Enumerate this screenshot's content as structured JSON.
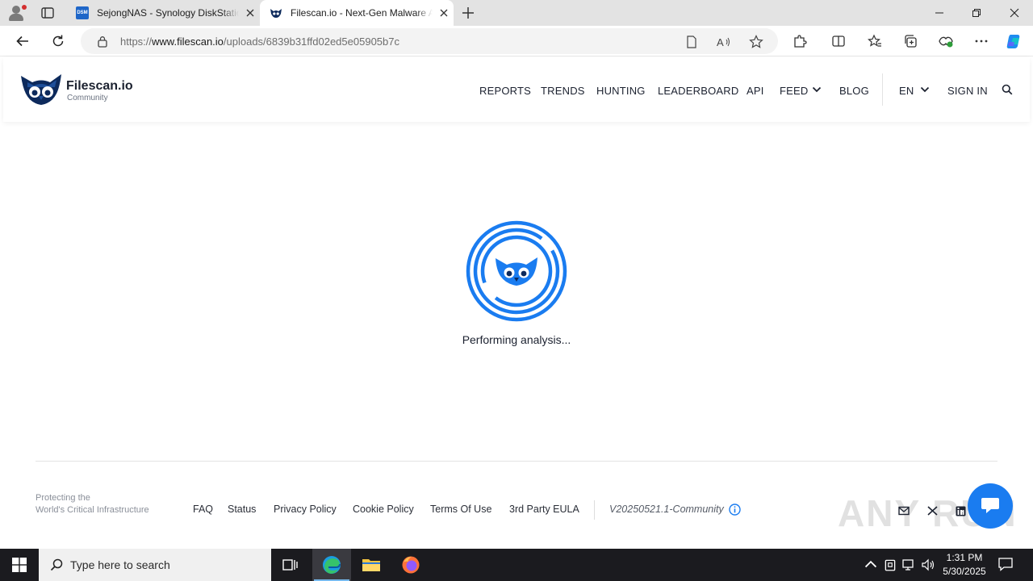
{
  "browser": {
    "tabs": [
      {
        "title": "SejongNAS - Synology DiskStation",
        "favicon": "DSM"
      },
      {
        "title": "Filescan.io - Next-Gen Malware Analysis"
      }
    ],
    "url_prefix": "https://",
    "url_domain": "www.filescan.io",
    "url_path": "/uploads/6839b31ffd02ed5e05905b7c"
  },
  "site": {
    "brand": "Filescan.io",
    "brand_sub": "Community",
    "nav": {
      "reports": "REPORTS",
      "trends": "TRENDS",
      "hunting": "HUNTING",
      "leaderboard": "LEADERBOARD",
      "api": "API",
      "feed": "FEED",
      "blog": "BLOG",
      "language": "EN",
      "signin": "SIGN IN"
    },
    "status": "Performing analysis..."
  },
  "footer": {
    "tagline_line1": "Protecting the",
    "tagline_line2": "World's Critical Infrastructure",
    "links": {
      "faq": "FAQ",
      "status": "Status",
      "privacy": "Privacy Policy",
      "cookie": "Cookie Policy",
      "terms": "Terms Of Use",
      "eula": "3rd Party EULA"
    },
    "version": "V20250521.1-Community",
    "watermark": "ANY RUN"
  },
  "taskbar": {
    "search_placeholder": "Type here to search",
    "time": "1:31 PM",
    "date": "5/30/2025"
  },
  "colors": {
    "accent": "#1a7cf0",
    "brand_dark": "#1c2230",
    "owl_navy": "#0d2a5c"
  }
}
